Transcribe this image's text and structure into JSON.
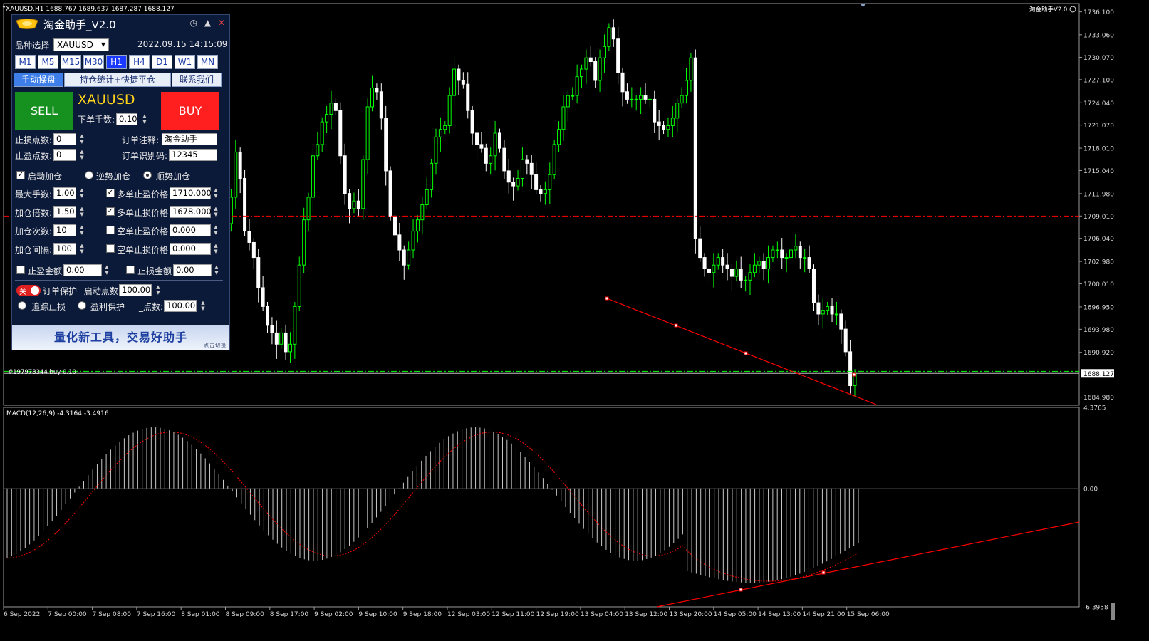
{
  "chart_header": {
    "symbol_line": "XAUUSD,H1  1688.767 1689.637 1687.287 1688.127",
    "indicator_label": "淘金助手V2.0",
    "macd_label": "MACD(12,26,9) -4.3164 -3.4916",
    "order_label": "#197978344 buy 0.10"
  },
  "colors": {
    "bull_candle": "#00ff00",
    "bear_candle": "#ffffff",
    "resistance_line": "#ff0000",
    "order_line": "#00ff00",
    "trendline": "#ff0000",
    "macd_hist": "#c8c8c8",
    "macd_signal": "#ff0000"
  },
  "chart_data": [
    {
      "type": "candlestick",
      "title": "XAUUSD,H1",
      "ylim": [
        1683.9,
        1737.2
      ],
      "y_ticks": [
        "1736.100",
        "1733.060",
        "1730.070",
        "1727.100",
        "1724.040",
        "1721.070",
        "1718.010",
        "1715.040",
        "1711.980",
        "1709.010",
        "1706.040",
        "1702.980",
        "1700.010",
        "1696.950",
        "1693.980",
        "1690.920",
        "1688.127",
        "1684.980"
      ],
      "x_ticks": [
        "6 Sep 2022",
        "7 Sep 00:00",
        "7 Sep 08:00",
        "7 Sep 16:00",
        "8 Sep 01:00",
        "8 Sep 09:00",
        "8 Sep 17:00",
        "9 Sep 02:00",
        "9 Sep 10:00",
        "9 Sep 18:00",
        "12 Sep 03:00",
        "12 Sep 11:00",
        "12 Sep 19:00",
        "13 Sep 04:00",
        "13 Sep 12:00",
        "13 Sep 20:00",
        "14 Sep 05:00",
        "14 Sep 13:00",
        "14 Sep 21:00",
        "15 Sep 06:00"
      ],
      "current_price": 1688.127,
      "horizontal_lines": [
        {
          "name": "resistance",
          "price": 1709.0,
          "style": "dash-dot"
        },
        {
          "name": "order",
          "price": 1688.4,
          "style": "dash-dot"
        }
      ],
      "closes": [
        1708.0,
        1711.5,
        1717.5,
        1714.0,
        1707.0,
        1705.5,
        1703.5,
        1699.5,
        1697.0,
        1694.5,
        1693.5,
        1692.0,
        1693.5,
        1691.0,
        1692.0,
        1697.0,
        1702.5,
        1708.5,
        1711.5,
        1717.0,
        1718.5,
        1721.5,
        1722.5,
        1724.0,
        1723.0,
        1717.0,
        1712.0,
        1710.0,
        1711.0,
        1710.0,
        1716.5,
        1723.5,
        1726.0,
        1725.5,
        1722.0,
        1715.0,
        1709.0,
        1706.5,
        1704.5,
        1702.5,
        1704.5,
        1707.0,
        1708.5,
        1710.5,
        1712.5,
        1716.0,
        1719.5,
        1720.5,
        1721.0,
        1725.0,
        1728.5,
        1727.0,
        1726.5,
        1723.0,
        1720.0,
        1718.5,
        1718.0,
        1716.0,
        1717.0,
        1720.0,
        1718.0,
        1715.0,
        1713.5,
        1713.0,
        1714.0,
        1716.5,
        1716.0,
        1714.5,
        1712.5,
        1712.0,
        1712.5,
        1714.5,
        1718.5,
        1720.5,
        1723.5,
        1725.0,
        1725.0,
        1727.5,
        1728.5,
        1730.0,
        1729.5,
        1727.0,
        1730.0,
        1731.5,
        1734.0,
        1732.5,
        1728.0,
        1725.5,
        1724.5,
        1724.5,
        1724.5,
        1725.0,
        1724.5,
        1724.5,
        1721.5,
        1721.0,
        1720.5,
        1721.0,
        1722.0,
        1724.0,
        1725.0,
        1727.0,
        1730.0,
        1706.0,
        1703.5,
        1702.0,
        1701.5,
        1702.5,
        1703.5,
        1702.5,
        1702.0,
        1701.0,
        1702.0,
        1700.5,
        1700.5,
        1701.5,
        1702.5,
        1703.0,
        1702.0,
        1703.5,
        1704.5,
        1704.5,
        1703.5,
        1703.5,
        1704.5,
        1705.0,
        1703.5,
        1703.5,
        1702.0,
        1697.5,
        1696.0,
        1696.5,
        1697.0,
        1696.0,
        1696.0,
        1694.0,
        1691.0,
        1686.5,
        1688.1
      ]
    },
    {
      "type": "macd",
      "title": "MACD(12,26,9)",
      "params": [
        12,
        26,
        9
      ],
      "macd_value": -4.3164,
      "signal_value": -3.4916,
      "ylim": [
        -6.3958,
        4.3765
      ],
      "y_ticks": [
        "4.3765",
        "0.00",
        "-6.3958"
      ]
    }
  ],
  "panel": {
    "title": "淘金助手_V2.0",
    "symbol_label": "品种选择",
    "symbol_value": "XAUUSD",
    "datetime": "2022.09.15 14:15:09",
    "timeframes": [
      "M1",
      "M5",
      "M15",
      "M30",
      "H1",
      "H4",
      "D1",
      "W1",
      "MN"
    ],
    "active_timeframe": "H1",
    "tabs": [
      "手动操盘",
      "持仓统计+快捷平仓",
      "联系我们"
    ],
    "sell_label": "SELL",
    "buy_label": "BUY",
    "symbol_big": "XAUUSD",
    "lot_label": "下单手数:",
    "lot_value": "0.10",
    "sl_points_label": "止损点数:",
    "sl_points_value": "0",
    "tp_points_label": "止盈点数:",
    "tp_points_value": "0",
    "comment_label": "订单注释:",
    "comment_value": "淘金助手",
    "magic_label": "订单识别码:",
    "magic_value": "12345",
    "enable_add_label": "启动加仓",
    "counter_trend_label": "逆势加仓",
    "with_trend_label": "顺势加仓",
    "max_lot_label": "最大手数:",
    "max_lot_value": "1.00",
    "multiplier_label": "加仓倍数:",
    "multiplier_value": "1.50",
    "add_times_label": "加仓次数:",
    "add_times_value": "10",
    "add_interval_label": "加仓间隔:",
    "add_interval_value": "100",
    "long_tp_label": "多单止盈价格",
    "long_tp_value": "1710.000",
    "long_sl_label": "多单止损价格",
    "long_sl_value": "1678.000",
    "short_tp_label": "空单止盈价格",
    "short_tp_value": "0.000",
    "short_sl_label": "空单止损价格",
    "short_sl_value": "0.000",
    "tp_amount_label": "止盈金额",
    "tp_amount_value": "0.00",
    "sl_amount_label": "止损金额",
    "sl_amount_value": "0.00",
    "toggle_label": "关",
    "protect_label": "订单保护 _启动点数:",
    "protect_value": "100.00",
    "trailing_label": "追踪止损",
    "profit_protect_label": "盈利保护",
    "points_label": "_点数:",
    "points_value": "100.00",
    "banner_text": "量化新工具，交易好助手",
    "banner_sub": "点击切换"
  }
}
